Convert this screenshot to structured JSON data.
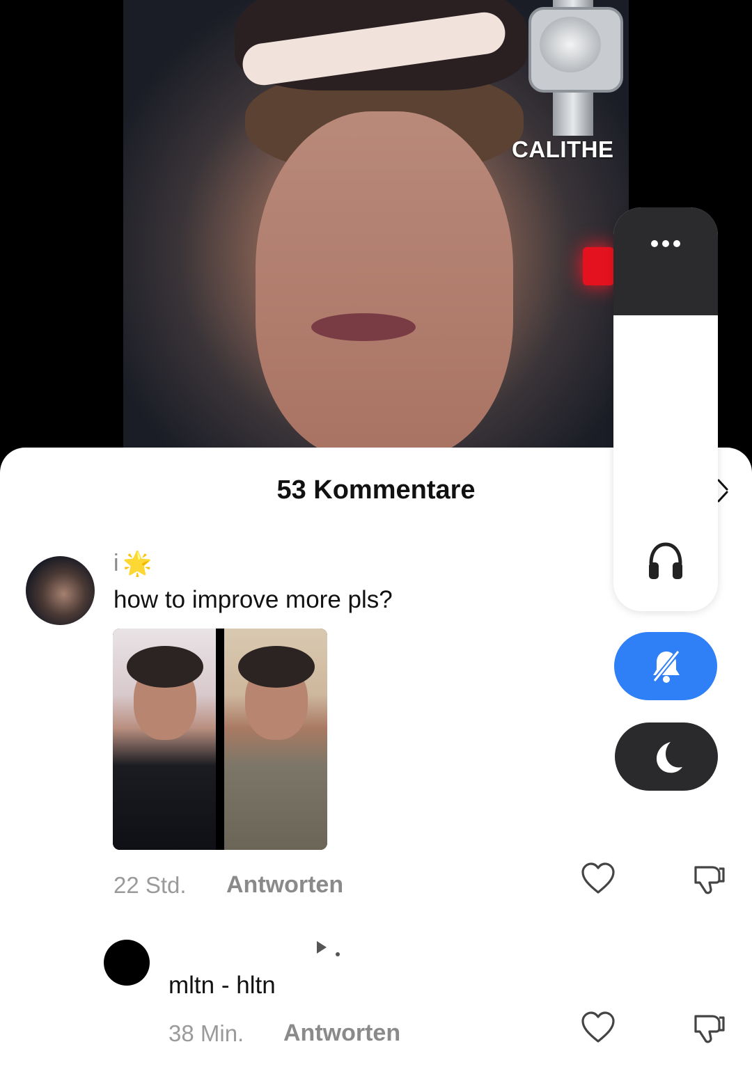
{
  "video": {
    "brand_text": "CALITHE"
  },
  "comments_sheet": {
    "title": "53 Kommentare"
  },
  "comments": [
    {
      "username": "i",
      "username_emoji": "🌟",
      "text": "how to improve more pls?",
      "has_photos": true,
      "time": "22 Std.",
      "reply_label": "Antworten"
    },
    {
      "username": "",
      "text": "mltn - hltn",
      "time": "38 Min.",
      "reply_label": "Antworten"
    }
  ],
  "controls": {
    "volume_level": 0.85,
    "mute_active": true,
    "dnd_active": false,
    "accent_color": "#2f7ff6"
  },
  "icons": {
    "close": "close-icon",
    "like": "heart-icon",
    "dislike": "thumbs-down-icon",
    "more": "more-dots-icon",
    "headphones": "headphones-icon",
    "mute": "bell-slash-icon",
    "dnd": "moon-icon"
  }
}
